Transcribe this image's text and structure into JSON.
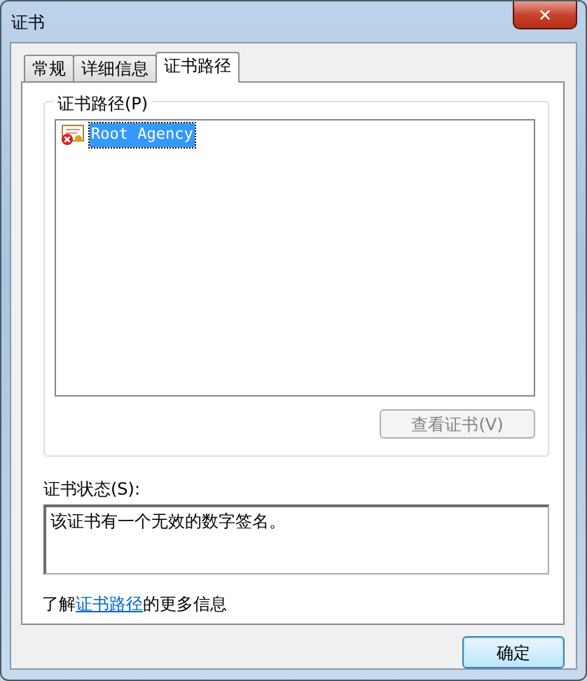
{
  "window": {
    "title": "证书",
    "close_label": "✕"
  },
  "tabs": [
    {
      "label": "常规",
      "selected": false
    },
    {
      "label": "详细信息",
      "selected": false
    },
    {
      "label": "证书路径",
      "selected": true
    }
  ],
  "path_group": {
    "title": "证书路径(P)",
    "items": [
      {
        "label": "Root Agency",
        "selected": true,
        "invalid": true
      }
    ],
    "view_button": {
      "label": "查看证书(V)",
      "disabled": true
    }
  },
  "status": {
    "label": "证书状态(S):",
    "value": "该证书有一个无效的数字签名。"
  },
  "info_link": {
    "before": "了解",
    "link": "证书路径",
    "after": "的更多信息"
  },
  "buttons": [
    {
      "label": "确定",
      "default": true
    }
  ]
}
